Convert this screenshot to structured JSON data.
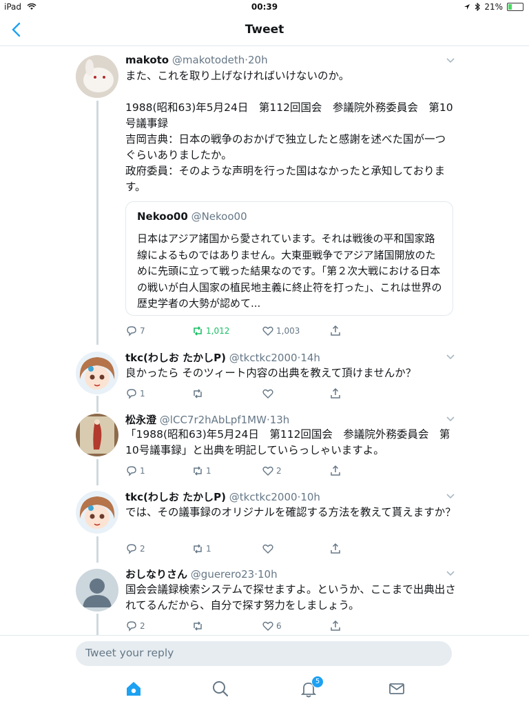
{
  "status_bar": {
    "device": "iPad",
    "time": "00:39",
    "battery": "21%",
    "battery_fraction": 0.21
  },
  "nav": {
    "title": "Tweet"
  },
  "main_tweet": {
    "name": "makoto",
    "handle": "@makotodeth",
    "time": "·20h",
    "text": "また、これを取り上げなければいけないのか。\n\n1988(昭和63)年5月24日　第112回国会　参議院外務委員会　第10号議事録\n吉岡吉典：日本の戦争のおかげで独立したと感謝を述べた国が一つぐらいありましたか。\n政府委員：そのような声明を行った国はなかったと承知しております。",
    "quote": {
      "name": "Nekoo00",
      "handle": "@Nekoo00",
      "text": "日本はアジア諸国から愛されています。それは戦後の平和国家路線によるものではありません。大東亜戦争でアジア諸国開放のために先頭に立って戦った結果なのです。「第２次大戦における日本の戦いが白人国家の植民地主義に終止符を打った」、これは世界の歴史学者の大勢が認めて..."
    },
    "reply_count": "7",
    "retweet_count": "1,012",
    "like_count": "1,003"
  },
  "replies": [
    {
      "name": "tkc(わしお たかしP)",
      "handle": "@tkctkc2000",
      "time": "·14h",
      "text": "良かったら そのツィート内容の出典を教えて頂けませんか？",
      "reply_count": "1",
      "retweet_count": "",
      "like_count": ""
    },
    {
      "name": "松永澄",
      "handle": "@lCC7r2hAbLpf1MW",
      "time": "·13h",
      "text": "「1988(昭和63)年5月24日　第112回国会　参議院外務委員会　第10号議事録」と出典を明記していらっしゃいますよ。",
      "reply_count": "1",
      "retweet_count": "1",
      "like_count": "2"
    },
    {
      "name": "tkc(わしお たかしP)",
      "handle": "@tkctkc2000",
      "time": "·10h",
      "text": "では、その議事録のオリジナルを確認する方法を教えて貰えますか？",
      "reply_count": "2",
      "retweet_count": "1",
      "like_count": ""
    },
    {
      "name": "おしなりさん",
      "handle": "@guerero23",
      "time": "·10h",
      "text": "国会会議録検索システムで探せますよ。というか、ここまで出典出されてるんだから、自分で探す努力をしましょう。",
      "reply_count": "2",
      "retweet_count": "",
      "like_count": "6"
    }
  ],
  "composer": {
    "placeholder": "Tweet your reply"
  },
  "tabbar": {
    "notifications_badge": "5"
  },
  "colors": {
    "accent": "#1da1f2",
    "retweet_active": "#17bf63",
    "secondary_text": "#657786",
    "divider": "#e1e8ed"
  },
  "icons": [
    "back-chevron-icon",
    "wifi-icon",
    "location-icon",
    "bluetooth-icon",
    "battery-icon",
    "caret-down-icon",
    "reply-icon",
    "retweet-icon",
    "like-icon",
    "share-icon",
    "home-icon",
    "search-icon",
    "notifications-icon",
    "messages-icon"
  ]
}
